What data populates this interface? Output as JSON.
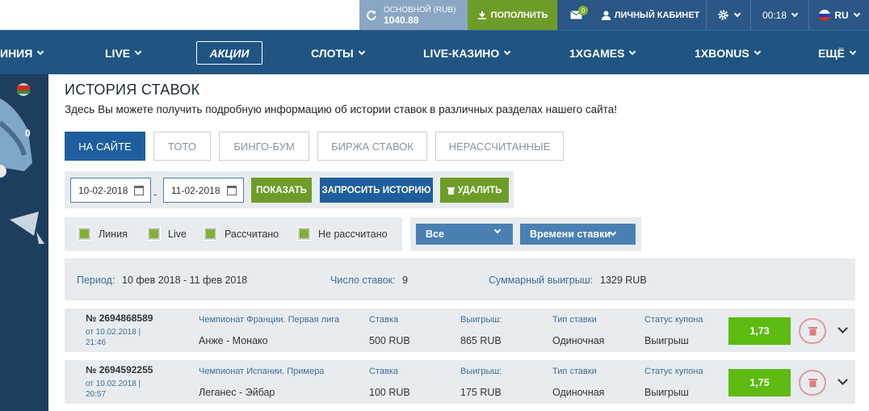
{
  "topbar": {
    "balance_label": "ОСНОВНОЙ (RUB)",
    "balance_value": "1040.88",
    "deposit_label": "ПОПОЛНИТЬ",
    "mail_count": "0",
    "cabinet_label": "ЛИЧНЫЙ КАБИНЕТ",
    "time": "00:18",
    "lang": "RU"
  },
  "nav": {
    "items": [
      "ИНИЯ",
      "LIVE",
      "АКЦИИ",
      "СЛОТЫ",
      "LIVE-КАЗИНО",
      "1XGAMES",
      "1XBONUS",
      "ЕЩЁ"
    ]
  },
  "leftpanel": {
    "score": "0"
  },
  "page": {
    "title": "ИСТОРИЯ СТАВОК",
    "subtitle": "Здесь Вы можете получить подробную информацию об истории ставок в различных разделах нашего сайта!"
  },
  "tabs": [
    "НА САЙТЕ",
    "ТОТО",
    "БИНГО-БУМ",
    "БИРЖА СТАВОК",
    "НЕРАССЧИТАННЫЕ"
  ],
  "filters": {
    "date_from": "10-02-2018",
    "date_to": "11-02-2018",
    "dash": "-",
    "show": "ПОКАЗАТЬ",
    "request": "ЗАПРОСИТЬ ИСТОРИЮ",
    "delete": "УДАЛИТЬ"
  },
  "checks": [
    "Линия",
    "Live",
    "Рассчитано",
    "Не рассчитано"
  ],
  "dropdowns": {
    "type": "Все",
    "sort": "Времени ставки"
  },
  "summary": {
    "period_label": "Период:",
    "period_value": "10 фев 2018 - 11 фев 2018",
    "count_label": "Число ставок:",
    "count_value": "9",
    "win_label": "Суммарный выигрыш:",
    "win_value": "1329 RUB"
  },
  "columns": {
    "stake": "Ставка",
    "win": "Выигрыш:",
    "type": "Тип ставки",
    "status": "Статус купона"
  },
  "bets": [
    {
      "num": "№ 2694868589",
      "from": "от 10.02.2018 | 21:46",
      "champ": "Чемпионат Франции. Первая лига",
      "teams": "Анже - Монако",
      "stake": "500 RUB",
      "win": "865 RUB",
      "type": "Одиночная",
      "status": "Выигрыш",
      "odds": "1,73"
    },
    {
      "num": "№ 2694592255",
      "from": "от 10.02.2018 | 20:57",
      "champ": "Чемпионат Испании. Примера",
      "teams": "Леганес - Эйбар",
      "stake": "100 RUB",
      "win": "175 RUB",
      "type": "Одиночная",
      "status": "Выигрыш",
      "odds": "1,75"
    }
  ],
  "colors": {
    "nav": "#1f5483",
    "accent": "#1f5e9e",
    "green": "#5dbb12",
    "olive": "#6d9d28"
  }
}
